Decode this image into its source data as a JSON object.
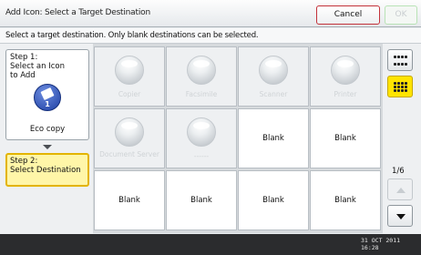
{
  "header": {
    "title": "Add Icon: Select a Target Destination",
    "cancel_label": "Cancel",
    "ok_label": "OK"
  },
  "instruction": "Select a target destination. Only blank destinations can be selected.",
  "steps": {
    "step1_text": "Step 1:\nSelect an Icon\nto Add",
    "selected_icon_number": "1",
    "selected_icon_label": "Eco copy",
    "step2_text": "Step 2:\nSelect Destination"
  },
  "destinations": [
    {
      "label": "Copier",
      "state": "occupied"
    },
    {
      "label": "Facsimile",
      "state": "occupied"
    },
    {
      "label": "Scanner",
      "state": "occupied"
    },
    {
      "label": "Printer",
      "state": "occupied"
    },
    {
      "label": "Document Server",
      "state": "occupied"
    },
    {
      "label": "------",
      "state": "occupied"
    },
    {
      "label": "Blank",
      "state": "blank"
    },
    {
      "label": "Blank",
      "state": "blank"
    },
    {
      "label": "Blank",
      "state": "blank"
    },
    {
      "label": "Blank",
      "state": "blank"
    },
    {
      "label": "Blank",
      "state": "blank"
    },
    {
      "label": "Blank",
      "state": "blank"
    }
  ],
  "view": {
    "small_grid_icon": "dots-grid-small-icon",
    "large_grid_icon": "dots-grid-large-icon",
    "active": "large"
  },
  "pager": {
    "page": "1/6"
  },
  "status": {
    "date": "31 OCT  2011",
    "time": "16:28"
  },
  "colors": {
    "cancel_border": "#c3323a",
    "ok_border": "#b9e3b6",
    "step2_highlight": "#fff6a8",
    "active_toggle": "#ffe400",
    "eco_icon": "#1d3fa3"
  }
}
